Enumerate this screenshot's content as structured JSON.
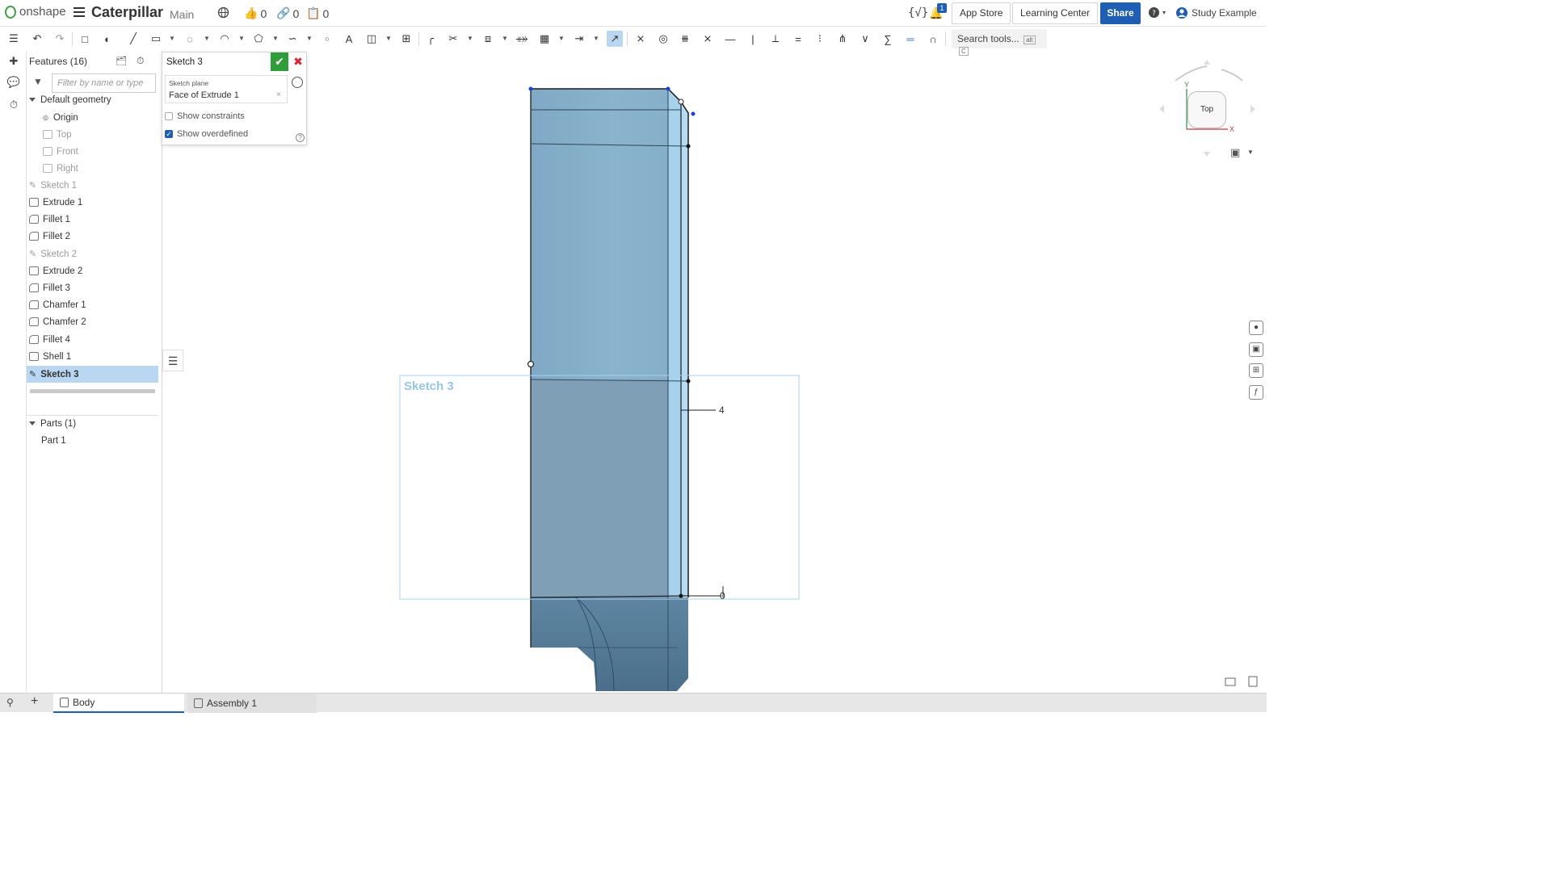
{
  "header": {
    "brand": "onshape",
    "doc_title": "Caterpillar",
    "branch": "Main",
    "likes": "0",
    "links": "0",
    "copies": "0",
    "notification_count": "1",
    "app_store": "App Store",
    "learning_center": "Learning Center",
    "share": "Share",
    "user": "Study Example"
  },
  "toolbar": {
    "search_tools": "Search tools...",
    "search_shortcut_1": "alt",
    "search_shortcut_2": "C"
  },
  "features": {
    "header": "Features (16)",
    "filter_placeholder": "Filter by name or type",
    "default_geometry": "Default geometry",
    "items": [
      {
        "label": "Origin"
      },
      {
        "label": "Top"
      },
      {
        "label": "Front"
      },
      {
        "label": "Right"
      },
      {
        "label": "Sketch 1"
      },
      {
        "label": "Extrude 1"
      },
      {
        "label": "Fillet 1"
      },
      {
        "label": "Fillet 2"
      },
      {
        "label": "Sketch 2"
      },
      {
        "label": "Extrude 2"
      },
      {
        "label": "Fillet 3"
      },
      {
        "label": "Chamfer 1"
      },
      {
        "label": "Chamfer 2"
      },
      {
        "label": "Fillet 4"
      },
      {
        "label": "Shell 1"
      },
      {
        "label": "Sketch 3"
      }
    ],
    "parts_header": "Parts (1)",
    "part": "Part 1"
  },
  "sketch_dialog": {
    "title": "Sketch 3",
    "plane_label": "Sketch plane",
    "plane_value": "Face of Extrude 1",
    "show_constraints": "Show constraints",
    "show_overdefined": "Show overdefined",
    "show_constraints_checked": false,
    "show_overdefined_checked": true
  },
  "viewport": {
    "sketch_label": "Sketch 3",
    "dimension_1": "4",
    "dimension_2": "0",
    "view_cube_face": "Top",
    "axis_y": "Y",
    "axis_x": "X"
  },
  "tabs": [
    {
      "label": "Body"
    },
    {
      "label": "Assembly 1"
    }
  ],
  "colors": {
    "accent": "#1f5fb3",
    "selection": "#b9d7f0",
    "confirm": "#2e9d3a",
    "cancel": "#dd2233",
    "part_face": "#85afc8"
  }
}
